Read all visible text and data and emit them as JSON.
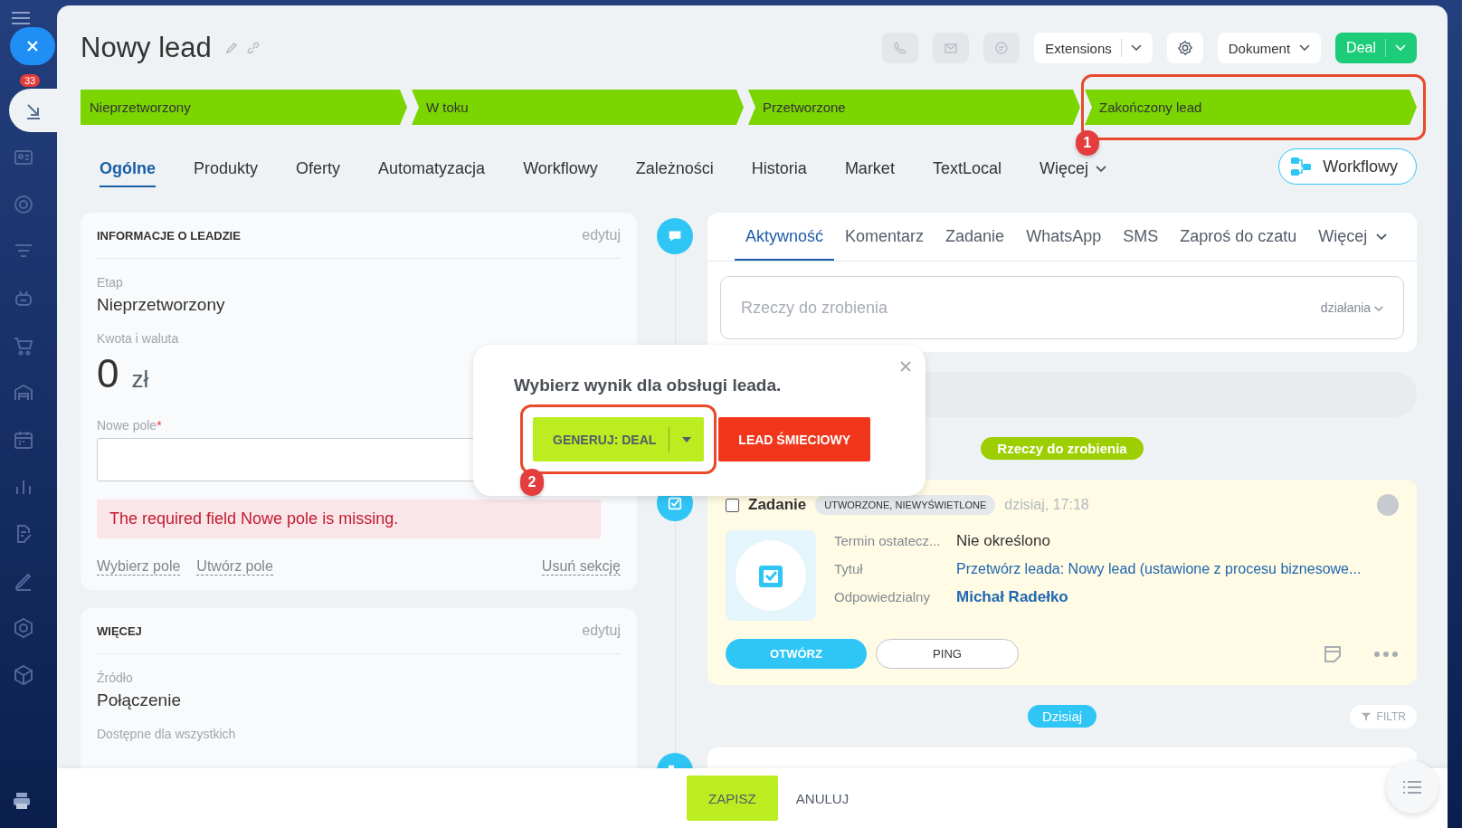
{
  "sidebar": {
    "counter": "33",
    "items": [
      {
        "selected": true
      },
      {
        "selected": false
      },
      {
        "selected": false
      },
      {
        "selected": false
      },
      {
        "selected": false
      },
      {
        "selected": false
      },
      {
        "selected": false
      },
      {
        "selected": false
      },
      {
        "selected": false
      },
      {
        "selected": false
      },
      {
        "selected": false
      },
      {
        "selected": false
      },
      {
        "selected": false
      }
    ]
  },
  "header": {
    "title": "Nowy lead",
    "extensions": "Extensions",
    "document": "Dokument",
    "convert": "Deal"
  },
  "stages": [
    {
      "label": "Nieprzetworzony",
      "reached": true
    },
    {
      "label": "W toku",
      "reached": true
    },
    {
      "label": "Przetworzone",
      "reached": true
    },
    {
      "label": "Zakończony lead",
      "reached": true
    }
  ],
  "tabs": [
    {
      "label": "Ogólne",
      "selected": true,
      "dropdown": false
    },
    {
      "label": "Produkty",
      "selected": false,
      "dropdown": false
    },
    {
      "label": "Oferty",
      "selected": false,
      "dropdown": false
    },
    {
      "label": "Automatyzacja",
      "selected": false,
      "dropdown": false
    },
    {
      "label": "Workflowy",
      "selected": false,
      "dropdown": false
    },
    {
      "label": "Zależności",
      "selected": false,
      "dropdown": false
    },
    {
      "label": "Historia",
      "selected": false,
      "dropdown": false
    },
    {
      "label": "Market",
      "selected": false,
      "dropdown": false
    },
    {
      "label": "TextLocal",
      "selected": false,
      "dropdown": false
    },
    {
      "label": "Więcej",
      "selected": false,
      "dropdown": true
    }
  ],
  "workflow_button": "Workflowy",
  "lead_info": {
    "title": "INFORMACJE O LEADZIE",
    "edit": "edytuj",
    "stage_label": "Etap",
    "stage_value": "Nieprzetworzony",
    "amount_label": "Kwota i waluta",
    "amount": "0",
    "currency": "zł",
    "field_label": "Nowe pole",
    "required_mark": "*",
    "error": "The required field Nowe pole is missing.",
    "links": [
      "Wybierz pole",
      "Utwórz pole"
    ],
    "delete_link": "Usuń sekcję"
  },
  "more_section": {
    "title": "WIĘCEJ",
    "edit": "edytuj",
    "source_label": "Źródło",
    "source_value": "Połączenie",
    "access_label": "Dostępne dla wszystkich"
  },
  "activity": {
    "tabs": [
      {
        "label": "Aktywność",
        "selected": true,
        "dropdown": false
      },
      {
        "label": "Komentarz",
        "selected": false,
        "dropdown": false
      },
      {
        "label": "Zadanie",
        "selected": false,
        "dropdown": false
      },
      {
        "label": "WhatsApp",
        "selected": false,
        "dropdown": false
      },
      {
        "label": "SMS",
        "selected": false,
        "dropdown": false
      },
      {
        "label": "Zaproś do czatu",
        "selected": false,
        "dropdown": false
      },
      {
        "label": "Więcej",
        "selected": false,
        "dropdown": true
      }
    ],
    "placeholder": "Rzeczy do zrobienia",
    "actions": "działania"
  },
  "todo_label": "Rzeczy do zrobienia",
  "task": {
    "checked": false,
    "title": "Zadanie",
    "status": "UTWORZONE, NIEWYŚWIETLONE",
    "time": "dzisiaj, 17:18",
    "rows": [
      {
        "label": "Termin ostatecz...",
        "value": "Nie określono",
        "kind": "plain"
      },
      {
        "label": "Tytuł",
        "value": "Przetwórz leada: Nowy lead (ustawione z procesu biznesowe...",
        "kind": "link"
      },
      {
        "label": "Odpowiedzialny",
        "value": "Michał Radełko",
        "kind": "person"
      }
    ],
    "open_button": "OTWÓRZ",
    "ping_button": "PING"
  },
  "today_label": "Dzisiaj",
  "filter": "FILTR",
  "footer": {
    "save": "ZAPISZ",
    "cancel": "ANULUJ"
  },
  "popup": {
    "title": "Wybierz wynik dla obsługi leada.",
    "generate": "GENERUJ: DEAL",
    "junk": "LEAD ŚMIECIOWY"
  },
  "annotations": [
    {
      "label": "1"
    },
    {
      "label": "2"
    }
  ]
}
